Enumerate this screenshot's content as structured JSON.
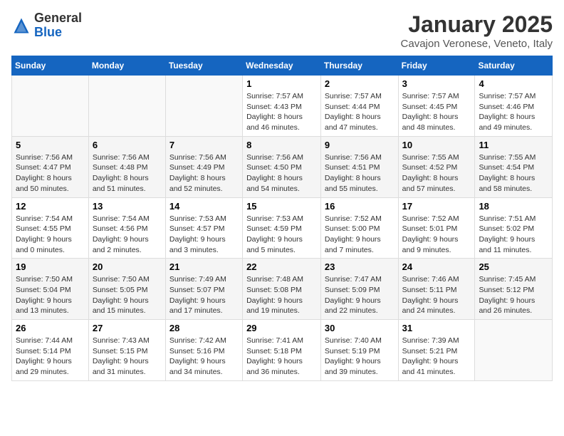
{
  "header": {
    "logo": {
      "general": "General",
      "blue": "Blue"
    },
    "title": "January 2025",
    "location": "Cavajon Veronese, Veneto, Italy"
  },
  "weekdays": [
    "Sunday",
    "Monday",
    "Tuesday",
    "Wednesday",
    "Thursday",
    "Friday",
    "Saturday"
  ],
  "weeks": [
    [
      {
        "day": "",
        "info": ""
      },
      {
        "day": "",
        "info": ""
      },
      {
        "day": "",
        "info": ""
      },
      {
        "day": "1",
        "info": "Sunrise: 7:57 AM\nSunset: 4:43 PM\nDaylight: 8 hours and 46 minutes."
      },
      {
        "day": "2",
        "info": "Sunrise: 7:57 AM\nSunset: 4:44 PM\nDaylight: 8 hours and 47 minutes."
      },
      {
        "day": "3",
        "info": "Sunrise: 7:57 AM\nSunset: 4:45 PM\nDaylight: 8 hours and 48 minutes."
      },
      {
        "day": "4",
        "info": "Sunrise: 7:57 AM\nSunset: 4:46 PM\nDaylight: 8 hours and 49 minutes."
      }
    ],
    [
      {
        "day": "5",
        "info": "Sunrise: 7:56 AM\nSunset: 4:47 PM\nDaylight: 8 hours and 50 minutes."
      },
      {
        "day": "6",
        "info": "Sunrise: 7:56 AM\nSunset: 4:48 PM\nDaylight: 8 hours and 51 minutes."
      },
      {
        "day": "7",
        "info": "Sunrise: 7:56 AM\nSunset: 4:49 PM\nDaylight: 8 hours and 52 minutes."
      },
      {
        "day": "8",
        "info": "Sunrise: 7:56 AM\nSunset: 4:50 PM\nDaylight: 8 hours and 54 minutes."
      },
      {
        "day": "9",
        "info": "Sunrise: 7:56 AM\nSunset: 4:51 PM\nDaylight: 8 hours and 55 minutes."
      },
      {
        "day": "10",
        "info": "Sunrise: 7:55 AM\nSunset: 4:52 PM\nDaylight: 8 hours and 57 minutes."
      },
      {
        "day": "11",
        "info": "Sunrise: 7:55 AM\nSunset: 4:54 PM\nDaylight: 8 hours and 58 minutes."
      }
    ],
    [
      {
        "day": "12",
        "info": "Sunrise: 7:54 AM\nSunset: 4:55 PM\nDaylight: 9 hours and 0 minutes."
      },
      {
        "day": "13",
        "info": "Sunrise: 7:54 AM\nSunset: 4:56 PM\nDaylight: 9 hours and 2 minutes."
      },
      {
        "day": "14",
        "info": "Sunrise: 7:53 AM\nSunset: 4:57 PM\nDaylight: 9 hours and 3 minutes."
      },
      {
        "day": "15",
        "info": "Sunrise: 7:53 AM\nSunset: 4:59 PM\nDaylight: 9 hours and 5 minutes."
      },
      {
        "day": "16",
        "info": "Sunrise: 7:52 AM\nSunset: 5:00 PM\nDaylight: 9 hours and 7 minutes."
      },
      {
        "day": "17",
        "info": "Sunrise: 7:52 AM\nSunset: 5:01 PM\nDaylight: 9 hours and 9 minutes."
      },
      {
        "day": "18",
        "info": "Sunrise: 7:51 AM\nSunset: 5:02 PM\nDaylight: 9 hours and 11 minutes."
      }
    ],
    [
      {
        "day": "19",
        "info": "Sunrise: 7:50 AM\nSunset: 5:04 PM\nDaylight: 9 hours and 13 minutes."
      },
      {
        "day": "20",
        "info": "Sunrise: 7:50 AM\nSunset: 5:05 PM\nDaylight: 9 hours and 15 minutes."
      },
      {
        "day": "21",
        "info": "Sunrise: 7:49 AM\nSunset: 5:07 PM\nDaylight: 9 hours and 17 minutes."
      },
      {
        "day": "22",
        "info": "Sunrise: 7:48 AM\nSunset: 5:08 PM\nDaylight: 9 hours and 19 minutes."
      },
      {
        "day": "23",
        "info": "Sunrise: 7:47 AM\nSunset: 5:09 PM\nDaylight: 9 hours and 22 minutes."
      },
      {
        "day": "24",
        "info": "Sunrise: 7:46 AM\nSunset: 5:11 PM\nDaylight: 9 hours and 24 minutes."
      },
      {
        "day": "25",
        "info": "Sunrise: 7:45 AM\nSunset: 5:12 PM\nDaylight: 9 hours and 26 minutes."
      }
    ],
    [
      {
        "day": "26",
        "info": "Sunrise: 7:44 AM\nSunset: 5:14 PM\nDaylight: 9 hours and 29 minutes."
      },
      {
        "day": "27",
        "info": "Sunrise: 7:43 AM\nSunset: 5:15 PM\nDaylight: 9 hours and 31 minutes."
      },
      {
        "day": "28",
        "info": "Sunrise: 7:42 AM\nSunset: 5:16 PM\nDaylight: 9 hours and 34 minutes."
      },
      {
        "day": "29",
        "info": "Sunrise: 7:41 AM\nSunset: 5:18 PM\nDaylight: 9 hours and 36 minutes."
      },
      {
        "day": "30",
        "info": "Sunrise: 7:40 AM\nSunset: 5:19 PM\nDaylight: 9 hours and 39 minutes."
      },
      {
        "day": "31",
        "info": "Sunrise: 7:39 AM\nSunset: 5:21 PM\nDaylight: 9 hours and 41 minutes."
      },
      {
        "day": "",
        "info": ""
      }
    ]
  ]
}
